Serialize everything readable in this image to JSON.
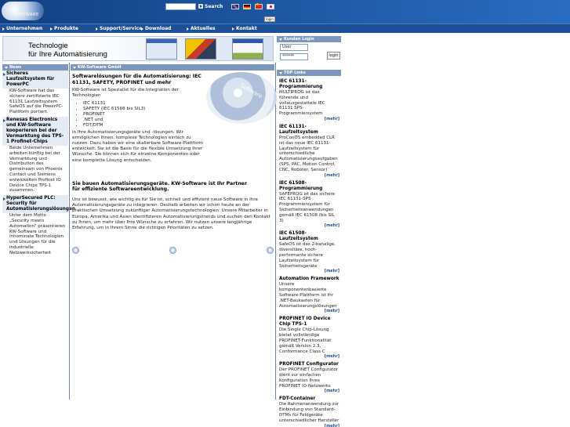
{
  "header": {
    "logo_text": "SOFTWARE",
    "search_placeholder": "",
    "search_label": "Search",
    "login_small": "login"
  },
  "nav": [
    "Unternehmen",
    "Produkte",
    "Support/Service",
    "Download",
    "Aktuelles",
    "Kontakt"
  ],
  "banner": {
    "line1": "Technologie",
    "line2": "für Ihre Automatisierung"
  },
  "left": {
    "heading": "News",
    "items": [
      {
        "title": "Sicheres Laufzeitsystem für PowerPC",
        "text": "KW-Software hat das sichere zertifizierte IEC 61131 Laufzeitsystem SafeOS auf die PowerPC-Plattform portiert."
      },
      {
        "title": "Renesas Electronics und KW-Software kooperieren bei der Vermarktung des TPS-1 Profinet-Chips",
        "text": "Beide Unternehmen arbeiten künftig bei der Vermarktung und Distribution des gemeinsam von Phoenix Contact und Siemens entwickelten Profinet IO Device Chips TPS-1 zusammen."
      },
      {
        "title": "HyperSecured PLC: Security für Automatisierungslösungen",
        "text": "Unter dem Motto „Security meets Automation\" präsentieren KW-Software und Innominate Technologien und Lösungen für die industrielle Netzwerksicherheit"
      }
    ]
  },
  "center": {
    "heading": "KW-Software GmbH",
    "section1_title": "Softwarelösungen für die Automatisierung: IEC 61131, SAFETY, PROFINET und mehr",
    "section1_intro": "KW-Software ist Spezialist für die Integration der Technologien",
    "bullets": [
      "IEC 61131",
      "SAFETY (IEC 61508 bis SIL3)",
      "PROFINET",
      ".NET und",
      "FDT/DTM"
    ],
    "section1_text": "in Ihre Automatisierungsgeräte und -lösungen. Wir ermöglichen Ihnen, komplexe Technologien einfach zu nutzen. Dazu haben wir eine skalierbare Software-Plattform entwickelt. Sie ist die Basis für die flexible Umsetzung Ihrer Wünsche. Sie können sich für einzelne Komponenten oder eine komplette Lösung entscheiden.",
    "section2_title": "Sie bauen Automatisierungsgeräte. KW-Software ist Ihr Partner für effiziente Softwareentwicklung.",
    "section2_text": "Uns ist bewusst, wie wichtig es für Sie ist, schnell und effizient neue Software in Ihre Automatisierungsgeräte zu integrieren. Deshalb arbeiten wir schon heute an der praktischen Umsetzung zukünftiger Automatisierungstechnologien: Unsere Mitarbeiter in Europa, Amerika und Asien identifizieren Automatisierungstrends und suchen den Kontakt zu Ihnen, um mehr über Ihre Wünsche zu erfahren. Wir nutzen unsere langjährige Erfahrung, um in Ihrem Sinne die richtigen Prioritäten zu setzen.",
    "cd_text": "Software"
  },
  "right": {
    "login_heading": "Kunden Login",
    "user_value": "User",
    "password_value": "******",
    "login_button": "login",
    "links_heading": "TOP Links",
    "more_label": "[mehr]",
    "links": [
      {
        "title": "IEC 61131-Programmierung",
        "text": "MULTIPROG ist das führende und vollausgestattete IEC 61131 SPS-Programmiersystem"
      },
      {
        "title": "IEC 61131-Laufzeitsystem",
        "text": "ProConOS embedded CLR ist das neue IEC 61131-Laufzeitsystem für unterschiedliche Automatisierungsaufgaben (SPS, PAC, Motion Control, CNC, Roboter, Sensor)"
      },
      {
        "title": "IEC 61508-Programmierung",
        "text": "SAFEPROG ist das sichere IEC 61131-SPS Programmiersystem für Sicherheitsanwendungen gemäß IEC 61508 (bis SIL 3)"
      },
      {
        "title": "IEC 61508-Laufzeitsystem",
        "text": "SafeOS ist das 2-kanalige, diversitäre, hoch-performante sichere Laufzeitsystem für Sicherheitsgeräte"
      },
      {
        "title": "Automation Framework",
        "text": "Unsere komponentenbasierte Software-Plattform ist Ihr .NET-Baukasten für Automatisierungslösungen"
      },
      {
        "title": "PROFINET IO Device Chip TPS-1",
        "text": "Die Single Chip-Lösung bietet vollständige PROFINET-Funktionalität gemäß Version 2.3, Conformance Class C"
      },
      {
        "title": "PROFINET Configurator",
        "text": "Der PROFINET Configurator dient zur einfachen Konfiguration Ihres PROFINET IO-Netzwerks"
      },
      {
        "title": "FDT-Container",
        "text": "Die Rahmenanwendung zur Einbindung von Standard-DTMs für Feldgeräte unterschiedlicher Hersteller"
      }
    ]
  }
}
